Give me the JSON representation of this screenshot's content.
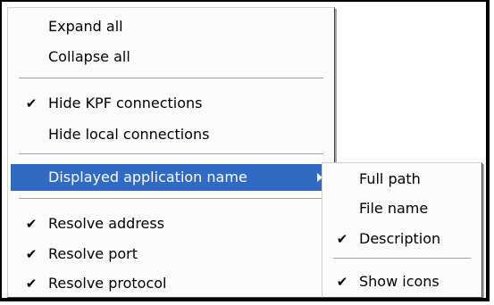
{
  "context_menu": {
    "items": [
      {
        "label": "Expand all",
        "checked": false
      },
      {
        "label": "Collapse all",
        "checked": false
      },
      {
        "label": "Hide KPF connections",
        "checked": true
      },
      {
        "label": "Hide local connections",
        "checked": false
      },
      {
        "label": "Displayed application name",
        "checked": false,
        "highlighted": true,
        "has_submenu": true
      },
      {
        "label": "Resolve address",
        "checked": true
      },
      {
        "label": "Resolve port",
        "checked": true
      },
      {
        "label": "Resolve protocol",
        "checked": true
      }
    ],
    "check_glyph": "✔"
  },
  "submenu": {
    "items": [
      {
        "label": "Full path",
        "checked": false
      },
      {
        "label": "File name",
        "checked": false
      },
      {
        "label": "Description",
        "checked": true
      },
      {
        "label": "Show icons",
        "checked": true
      }
    ]
  },
  "colors": {
    "highlight_bg": "#316ac5",
    "highlight_text": "#ffffff"
  }
}
